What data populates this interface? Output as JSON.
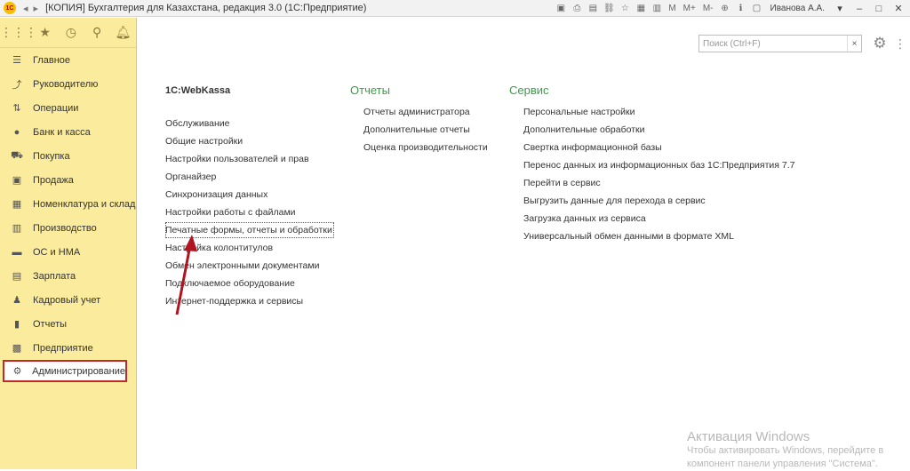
{
  "titlebar": {
    "logo": "1С",
    "title": "[КОПИЯ] Бухгалтерия для Казахстана, редакция 3.0  (1С:Предприятие)",
    "mem_labels": [
      "M",
      "M+",
      "M-"
    ],
    "user": "Иванова А.А."
  },
  "sidebar": {
    "items": [
      {
        "label": "Главное",
        "icon": "menu-icon"
      },
      {
        "label": "Руководителю",
        "icon": "trend-icon"
      },
      {
        "label": "Операции",
        "icon": "operations-icon"
      },
      {
        "label": "Банк и касса",
        "icon": "bank-icon"
      },
      {
        "label": "Покупка",
        "icon": "cart-icon"
      },
      {
        "label": "Продажа",
        "icon": "bag-icon"
      },
      {
        "label": "Номенклатура и склад",
        "icon": "warehouse-icon"
      },
      {
        "label": "Производство",
        "icon": "factory-icon"
      },
      {
        "label": "ОС и НМА",
        "icon": "truck-icon"
      },
      {
        "label": "Зарплата",
        "icon": "money-icon"
      },
      {
        "label": "Кадровый учет",
        "icon": "people-icon"
      },
      {
        "label": "Отчеты",
        "icon": "chart-icon"
      },
      {
        "label": "Предприятие",
        "icon": "building-icon"
      },
      {
        "label": "Администрирование",
        "icon": "gear-icon"
      }
    ]
  },
  "search": {
    "placeholder": "Поиск (Ctrl+F)",
    "clear": "×"
  },
  "columns": {
    "webkassa": {
      "header": "1С:WebKassa",
      "links": [
        "Обслуживание",
        "Общие настройки",
        "Настройки пользователей и прав",
        "Органайзер",
        "Синхронизация данных",
        "Настройки работы с файлами",
        "Печатные формы, отчеты и обработки",
        "Настройка колонтитулов",
        "Обмен электронными документами",
        "Подключаемое оборудование",
        "Интернет-поддержка и сервисы"
      ]
    },
    "reports": {
      "header": "Отчеты",
      "links": [
        "Отчеты администратора",
        "Дополнительные отчеты",
        "Оценка производительности"
      ]
    },
    "service": {
      "header": "Сервис",
      "links": [
        "Персональные настройки",
        "Дополнительные обработки",
        "Свертка информационной базы",
        "Перенос данных из информационных баз 1С:Предприятия 7.7",
        "Перейти в сервис",
        "Выгрузить данные для перехода в сервис",
        "Загрузка данных из сервиса",
        "Универсальный обмен данными в формате XML"
      ]
    }
  },
  "watermark": {
    "title": "Активация Windows",
    "line1": "Чтобы активировать Windows, перейдите в",
    "line2": "компонент панели управления \"Система\"."
  },
  "colors": {
    "sidebar_bg": "#fbeb9c",
    "section_header": "#3d9a4b",
    "highlight": "#c12a2a"
  }
}
